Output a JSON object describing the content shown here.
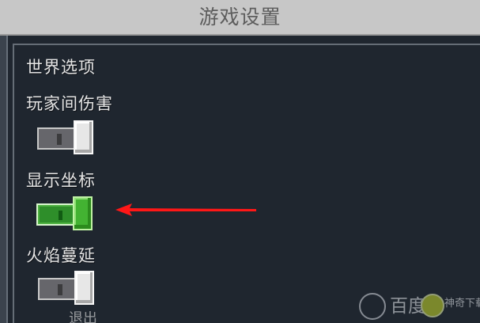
{
  "header": {
    "title": "游戏设置"
  },
  "settings": {
    "section_title": "世界选项",
    "items": [
      {
        "label": "玩家间伤害",
        "enabled": false
      },
      {
        "label": "显示坐标",
        "enabled": true
      },
      {
        "label": "火焰蔓延",
        "enabled": false
      }
    ]
  },
  "watermark": {
    "text": "百度",
    "site": "神奇下载"
  },
  "colors": {
    "background": "#1f262f",
    "title_bar": "#c7c7c7",
    "toggle_on": "#43b332",
    "toggle_off": "#66666b",
    "annotation_arrow": "#ff1717"
  },
  "icons": {
    "annotation": "red-arrow-pointer"
  }
}
